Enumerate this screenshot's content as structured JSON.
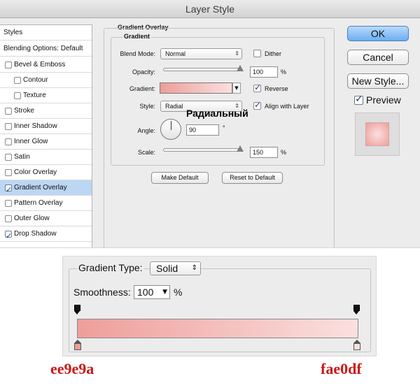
{
  "dialog": {
    "title": "Layer Style",
    "styles_list": {
      "header": "Styles",
      "blending": "Blending Options: Default",
      "items": [
        {
          "label": "Bevel & Emboss",
          "checked": false,
          "indent": false,
          "selected": false
        },
        {
          "label": "Contour",
          "checked": false,
          "indent": true,
          "selected": false
        },
        {
          "label": "Texture",
          "checked": false,
          "indent": true,
          "selected": false
        },
        {
          "label": "Stroke",
          "checked": false,
          "indent": false,
          "selected": false
        },
        {
          "label": "Inner Shadow",
          "checked": false,
          "indent": false,
          "selected": false
        },
        {
          "label": "Inner Glow",
          "checked": false,
          "indent": false,
          "selected": false
        },
        {
          "label": "Satin",
          "checked": false,
          "indent": false,
          "selected": false
        },
        {
          "label": "Color Overlay",
          "checked": false,
          "indent": false,
          "selected": false
        },
        {
          "label": "Gradient Overlay",
          "checked": true,
          "indent": false,
          "selected": true
        },
        {
          "label": "Pattern Overlay",
          "checked": false,
          "indent": false,
          "selected": false
        },
        {
          "label": "Outer Glow",
          "checked": false,
          "indent": false,
          "selected": false
        },
        {
          "label": "Drop Shadow",
          "checked": true,
          "indent": false,
          "selected": false
        }
      ]
    },
    "gradient_overlay": {
      "section_title": "Gradient Overlay",
      "group_title": "Gradient",
      "blend_mode_label": "Blend Mode:",
      "blend_mode_value": "Normal",
      "dither_label": "Dither",
      "dither_checked": false,
      "opacity_label": "Opacity:",
      "opacity_value": "100",
      "opacity_unit": "%",
      "opacity_fraction": 1.0,
      "gradient_label": "Gradient:",
      "reverse_label": "Reverse",
      "reverse_checked": true,
      "style_label": "Style:",
      "style_value": "Radial",
      "style_overlay_text": "Радиальный",
      "align_label": "Align with Layer",
      "align_checked": true,
      "angle_label": "Angle:",
      "angle_value": "90",
      "angle_unit": "°",
      "scale_label": "Scale:",
      "scale_value": "150",
      "scale_unit": "%",
      "scale_fraction": 1.0,
      "make_default_label": "Make Default",
      "reset_default_label": "Reset to Default"
    },
    "buttons": {
      "ok": "OK",
      "cancel": "Cancel",
      "new_style": "New Style...",
      "preview_label": "Preview",
      "preview_checked": true
    }
  },
  "gradient_editor": {
    "type_label": "Gradient Type:",
    "type_value": "Solid",
    "smoothness_label": "Smoothness:",
    "smoothness_value": "100",
    "smoothness_unit": "%",
    "stops": {
      "left_color": "#ee9e9a",
      "right_color": "#fae0df",
      "left_hex_label": "ee9e9a",
      "right_hex_label": "fae0df"
    }
  },
  "colors": {
    "accent_label": "#c81a1a",
    "selection": "#bcd7f3",
    "ok_button": "#6aaef1"
  }
}
